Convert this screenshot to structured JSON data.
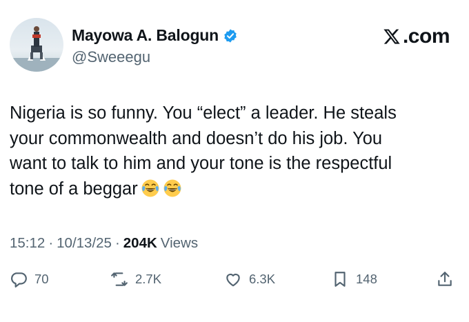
{
  "author": {
    "display_name": "Mayowa A. Balogun",
    "handle": "@Sweeegu",
    "verified": true,
    "verified_color": "#1d9bf0"
  },
  "brand": {
    "logo_icon": "x-logo-icon",
    "label": ".com"
  },
  "tweet": {
    "text": "Nigeria is so funny. You “elect” a leader. He steals\nyour commonwealth and doesn’t do his job. You\nwant to talk to him and your tone is the respectful\ntone of a beggar",
    "emojis": [
      "face-with-tears-of-joy-icon",
      "face-with-tears-of-joy-icon"
    ]
  },
  "meta": {
    "time": "15:12",
    "date": "10/13/25",
    "views_count": "204K",
    "views_label": "Views"
  },
  "actions": {
    "replies": "70",
    "reposts": "2.7K",
    "likes": "6.3K",
    "bookmarks": "148"
  }
}
